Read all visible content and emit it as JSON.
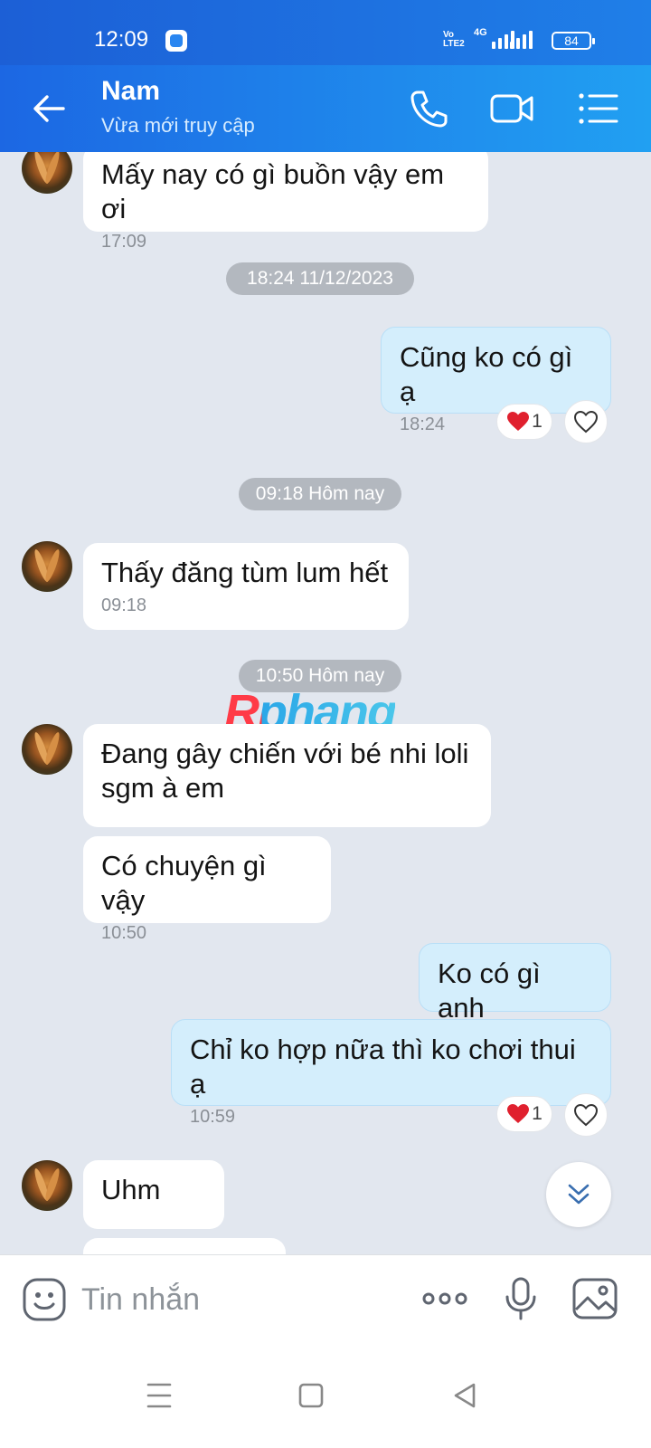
{
  "status_bar": {
    "time": "12:09",
    "volte_top": "Vo",
    "volte_bottom": "LTE2",
    "network": "4G",
    "battery": "84"
  },
  "header": {
    "contact_name": "Nam",
    "contact_status": "Vừa mới truy cập",
    "icons": [
      "back-arrow-icon",
      "phone-icon",
      "video-call-icon",
      "menu-list-icon"
    ]
  },
  "chat": {
    "messages": [
      {
        "from": "contact",
        "text": "Mấy nay có gì buồn vậy em ơi",
        "time": "17:09"
      },
      {
        "divider": "18:24 11/12/2023"
      },
      {
        "from": "me",
        "text": "Cũng ko có gì ạ",
        "time": "18:24",
        "reaction_count": "1"
      },
      {
        "divider": "09:18 Hôm nay"
      },
      {
        "from": "contact",
        "text": "Thấy đăng tùm lum hết",
        "time": "09:18"
      },
      {
        "divider": "10:50 Hôm nay"
      },
      {
        "from": "contact",
        "text": "Đang gây chiến với bé nhi loli sgm à em",
        "time": ""
      },
      {
        "from": "contact",
        "text": "Có chuyện gì vậy",
        "time": "10:50"
      },
      {
        "from": "me",
        "text": "Ko có gì anh",
        "time": ""
      },
      {
        "from": "me",
        "text": "Chỉ ko hợp nữa thì ko chơi thui ạ",
        "time": "10:59",
        "reaction_count": "1"
      },
      {
        "from": "contact",
        "text": "Uhm",
        "time": ""
      }
    ],
    "watermark": "Rphang"
  },
  "input_bar": {
    "placeholder": "Tin nhắn",
    "icons": [
      "emoji-icon",
      "more-dots-icon",
      "microphone-icon",
      "image-icon"
    ]
  },
  "colors": {
    "header_start": "#1c67e3",
    "header_end": "#21a0f2",
    "chat_background": "#e2e7ef",
    "outgoing_bubble": "#d4eefc",
    "incoming_bubble": "#ffffff",
    "heart": "#e0202e"
  }
}
